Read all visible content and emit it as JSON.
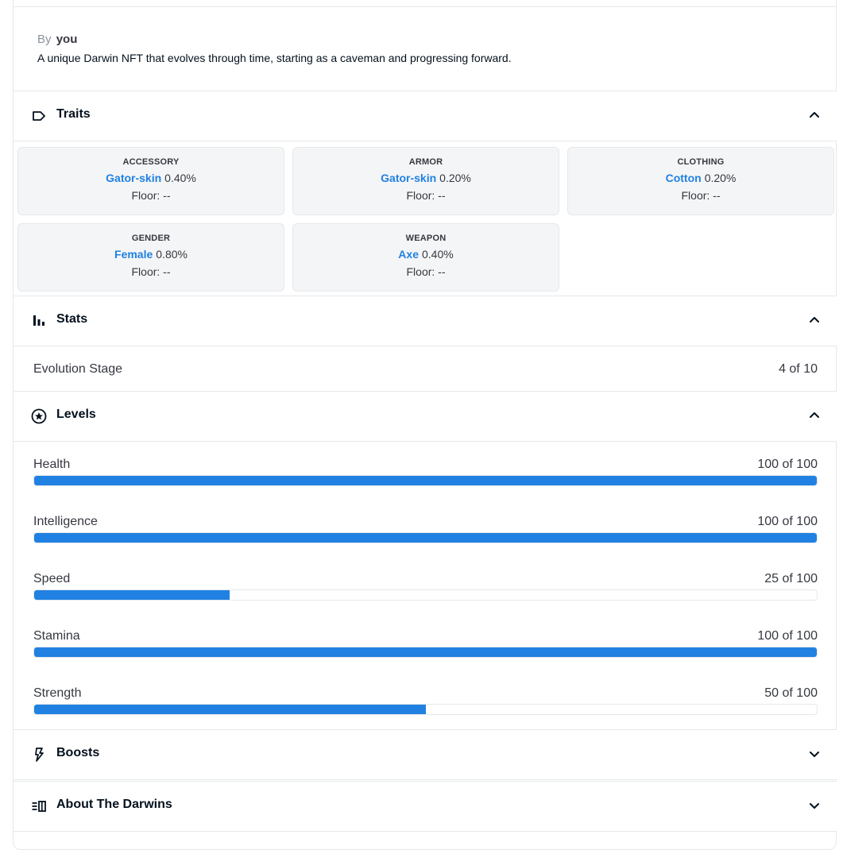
{
  "header": {
    "by_label": "By",
    "owner": "you",
    "description": "A unique Darwin NFT that evolves through time, starting as a caveman and progressing forward."
  },
  "sections": {
    "traits": "Traits",
    "stats": "Stats",
    "levels": "Levels",
    "boosts": "Boosts",
    "about": "About The Darwins"
  },
  "traits": [
    {
      "type": "ACCESSORY",
      "value": "Gator-skin",
      "pct": "0.40%",
      "floor": "Floor: --"
    },
    {
      "type": "ARMOR",
      "value": "Gator-skin",
      "pct": "0.20%",
      "floor": "Floor: --"
    },
    {
      "type": "CLOTHING",
      "value": "Cotton",
      "pct": "0.20%",
      "floor": "Floor: --"
    },
    {
      "type": "GENDER",
      "value": "Female",
      "pct": "0.80%",
      "floor": "Floor: --"
    },
    {
      "type": "WEAPON",
      "value": "Axe",
      "pct": "0.40%",
      "floor": "Floor: --"
    }
  ],
  "stats": [
    {
      "label": "Evolution Stage",
      "value": "4 of 10"
    }
  ],
  "levels": [
    {
      "label": "Health",
      "value": "100 of 100",
      "fraction": 1.0
    },
    {
      "label": "Intelligence",
      "value": "100 of 100",
      "fraction": 1.0
    },
    {
      "label": "Speed",
      "value": "25 of 100",
      "fraction": 0.25
    },
    {
      "label": "Stamina",
      "value": "100 of 100",
      "fraction": 1.0
    },
    {
      "label": "Strength",
      "value": "50 of 100",
      "fraction": 0.5
    }
  ],
  "colors": {
    "accent": "#2081e2",
    "border": "#e5e8eb",
    "trait_bg": "#f4f5f6"
  },
  "icons": {
    "traits": "tag-icon",
    "stats": "bar-chart-icon",
    "levels": "star-circle-icon",
    "boosts": "bolt-icon",
    "about": "book-icon",
    "expanded": "chevron-up-icon",
    "collapsed": "chevron-down-icon"
  }
}
